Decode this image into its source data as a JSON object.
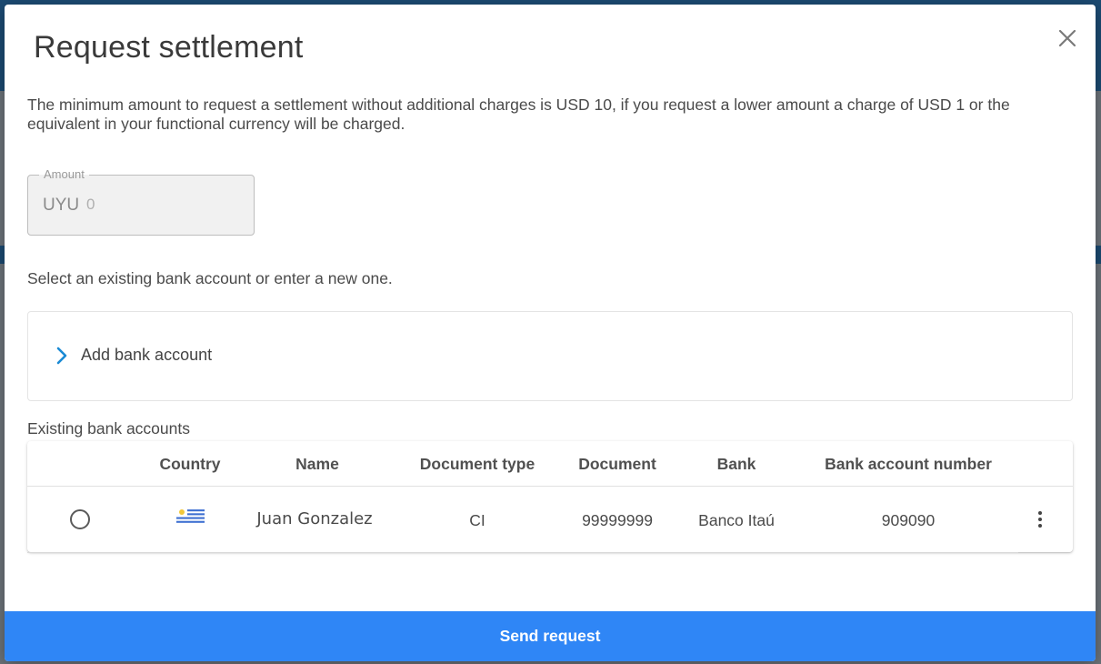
{
  "modal": {
    "title": "Request settlement",
    "intro": "The minimum amount to request a settlement without additional charges is USD 10, if you request a lower amount a charge of USD 1 or the equivalent in your functional currency will be charged."
  },
  "amount": {
    "label": "Amount",
    "currency": "UYU",
    "placeholder": "0",
    "value": ""
  },
  "bank": {
    "select_text": "Select an existing bank account or enter a new one.",
    "add_label": "Add bank account",
    "existing_label": "Existing bank accounts"
  },
  "table": {
    "columns": [
      "Country",
      "Name",
      "Document type",
      "Document",
      "Bank",
      "Bank account number"
    ],
    "rows": [
      {
        "country_flag": "uruguay-flag-icon",
        "name": "Juan Gonzalez",
        "document_type": "CI",
        "document": "99999999",
        "bank": "Banco Itaú",
        "account_number": "909090"
      }
    ]
  },
  "actions": {
    "send_label": "Send request"
  },
  "colors": {
    "primary": "#2f86f6",
    "accent_chevron": "#1a8ad4",
    "text": "#4a4a4a"
  }
}
